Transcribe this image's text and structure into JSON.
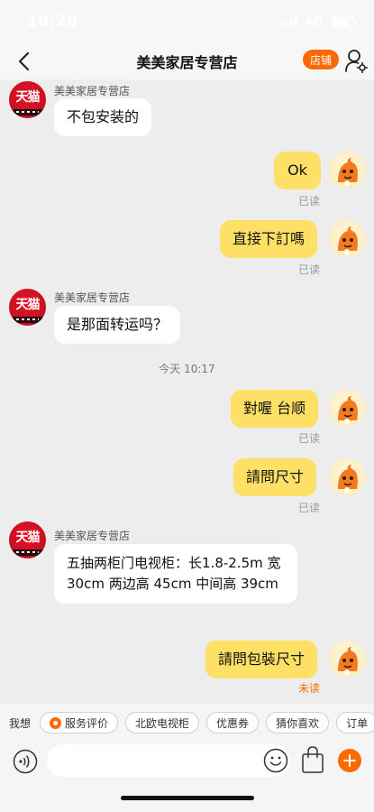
{
  "status_bar": {
    "time": "10:20",
    "network": "4G"
  },
  "header": {
    "title": "美美家居专营店",
    "store_button": "店铺"
  },
  "shop": {
    "name": "美美家居专营店",
    "avatar_text": "天猫"
  },
  "messages": [
    {
      "text": "不包安装的"
    },
    {
      "text": "Ok",
      "status": "已读"
    },
    {
      "text": "直接下訂嗎",
      "status": "已读"
    },
    {
      "text": "是那面转运吗？"
    },
    {
      "text": "對喔 台顺",
      "status": "已读"
    },
    {
      "text": "請問尺寸",
      "status": "已读"
    },
    {
      "text": "五抽两柜门电视柜：长1.8-2.5m 宽 30cm 两边高 45cm 中间高 39cm"
    },
    {
      "text": "請問包裝尺寸",
      "status": "未读"
    }
  ],
  "timestamp": "今天 10:17",
  "quick_bar": {
    "label": "我想",
    "chips": [
      "服务评价",
      "北欧电视柜",
      "优惠券",
      "猜你喜欢",
      "订单"
    ]
  },
  "input": {
    "value": "",
    "placeholder": ""
  },
  "colors": {
    "accent": "#ff6a00",
    "outgoing_bubble": "#ffe066",
    "unread": "#ff6a00"
  }
}
